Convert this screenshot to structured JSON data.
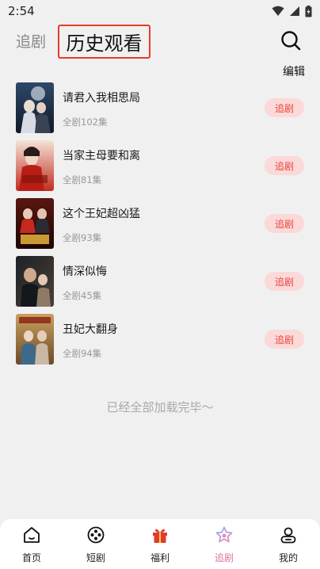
{
  "status_bar": {
    "time": "2:54",
    "icons": [
      "wifi-icon",
      "signal-icon",
      "battery-icon"
    ]
  },
  "header": {
    "tab_inactive": "追剧",
    "tab_active": "历史观看",
    "search_icon": "search-icon"
  },
  "edit_label": "编辑",
  "history": [
    {
      "title": "请君入我相思局",
      "episodes": "全剧102集",
      "button": "追剧",
      "poster_text": ""
    },
    {
      "title": "当家主母要和离",
      "episodes": "全剧81集",
      "button": "追剧",
      "poster_text": ""
    },
    {
      "title": "这个王妃超凶猛",
      "episodes": "全剧93集",
      "button": "追剧",
      "poster_text": ""
    },
    {
      "title": "情深似悔",
      "episodes": "全剧45集",
      "button": "追剧",
      "poster_text": ""
    },
    {
      "title": "丑妃大翻身",
      "episodes": "全剧94集",
      "button": "追剧",
      "poster_text": ""
    }
  ],
  "end_text": "已经全部加载完毕～",
  "tabbar": [
    {
      "label": "首页",
      "icon": "home-icon",
      "active": false
    },
    {
      "label": "短剧",
      "icon": "film-reel-icon",
      "active": false
    },
    {
      "label": "福利",
      "icon": "gift-icon",
      "active": false
    },
    {
      "label": "追剧",
      "icon": "star-icon",
      "active": true
    },
    {
      "label": "我的",
      "icon": "user-icon",
      "active": false
    }
  ],
  "colors": {
    "accent_red": "#e53b2c",
    "follow_bg": "#fbd9d8",
    "follow_text": "#e8463d",
    "active_tab": "#e072a4",
    "background": "#f0f0f0"
  }
}
